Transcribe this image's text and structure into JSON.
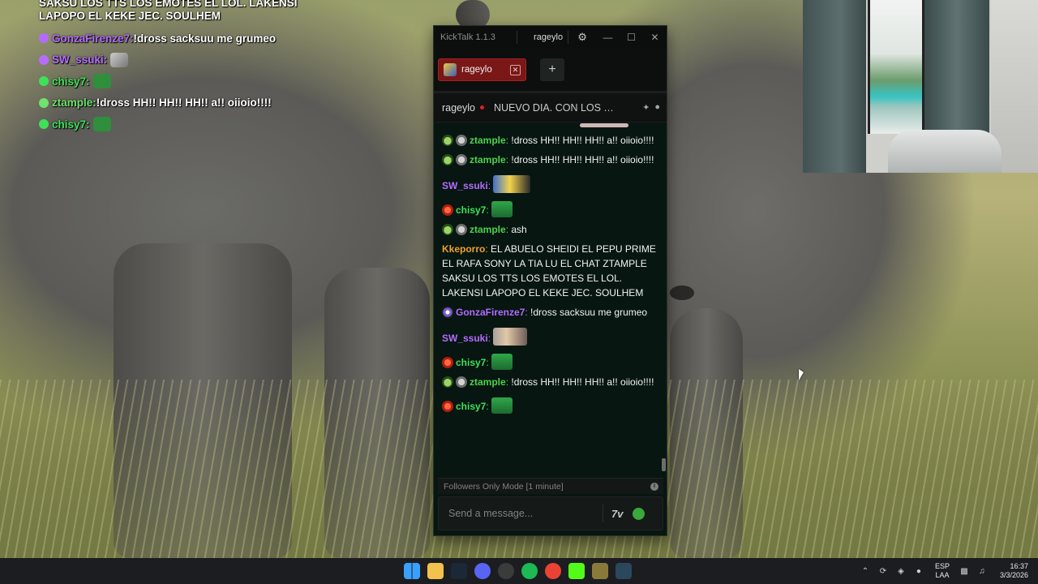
{
  "overlay_chat": {
    "lines": [
      {
        "text": "SAKSU LOS TTS LOS EMOTES EL LOL. LAKENSI LAPOPO EL KEKE JEC. SOULHEM",
        "color": "#ffffff"
      },
      {
        "user": "GonzaFirenze7",
        "sep": ":",
        "text": " !dross sacksuu me grumeo",
        "color": "#b36bff"
      },
      {
        "user": "SW_ssuki",
        "sep": ":",
        "text": "",
        "color": "#b56dff"
      },
      {
        "user": "chisy7",
        "sep": ":",
        "text": "",
        "color": "#3fe05a"
      },
      {
        "user": "ztample",
        "sep": ":",
        "text": " !dross HH!! HH!! HH!! a!! oiioio!!!!",
        "color": "#6ee36e"
      },
      {
        "user": "chisy7",
        "sep": ":",
        "text": "",
        "color": "#3fe05a"
      }
    ]
  },
  "window": {
    "app_title": "KickTalk 1.1.3",
    "user": "rageylo",
    "tab_label": "rageylo",
    "add_tab": "+",
    "channel_name": "rageylo",
    "stream_title": "NUEVO DIA. CON LOS TI...",
    "followers_notice": "Followers Only Mode [1 minute]",
    "input_placeholder": "Send a message...",
    "info": "i",
    "emote_btn": "7v"
  },
  "colors": {
    "green_user": "#3fe05a",
    "purple_user": "#b56dff",
    "orange_user": "#f0a12a",
    "tab_bg": "#7a1717"
  },
  "messages": [
    {
      "badges": [
        "bot",
        "gray"
      ],
      "user": "ztample",
      "user_color": "#4fd14f",
      "text": " !dross HH!! HH!! HH!! a!! oiioio!!!!",
      "emote": ""
    },
    {
      "badges": [
        "bot",
        "gray"
      ],
      "user": "ztample",
      "user_color": "#4fd14f",
      "text": " !dross HH!! HH!! HH!! a!! oiioio!!!!",
      "emote": ""
    },
    {
      "badges": [],
      "user": "SW_ssuki",
      "user_color": "#b56dff",
      "text": "",
      "emote": "pic"
    },
    {
      "badges": [
        "red"
      ],
      "user": "chisy7",
      "user_color": "#3fe05a",
      "text": "",
      "emote": "green"
    },
    {
      "badges": [
        "bot",
        "gray"
      ],
      "user": "ztample",
      "user_color": "#4fd14f",
      "text": " ash",
      "emote": ""
    },
    {
      "badges": [],
      "user": "Kkeporro",
      "user_color": "#f0a12a",
      "text": " EL ABUELO SHEIDI EL PEPU PRIME EL RAFA SONY LA TIA LU EL CHAT ZTAMPLE SAKSU LOS TTS LOS EMOTES EL LOL. LAKENSI LAPOPO EL KEKE JEC. SOULHEM",
      "emote": ""
    },
    {
      "badges": [
        "gonza"
      ],
      "user": "GonzaFirenze7",
      "user_color": "#b36bff",
      "text": " !dross sacksuu me grumeo",
      "emote": ""
    },
    {
      "badges": [],
      "user": "SW_ssuki",
      "user_color": "#b56dff",
      "text": "",
      "emote": "pic2"
    },
    {
      "badges": [
        "red"
      ],
      "user": "chisy7",
      "user_color": "#3fe05a",
      "text": "",
      "emote": "green"
    },
    {
      "badges": [
        "bot",
        "gray"
      ],
      "user": "ztample",
      "user_color": "#4fd14f",
      "text": " !dross HH!! HH!! HH!! a!! oiioio!!!!",
      "emote": ""
    },
    {
      "badges": [
        "red"
      ],
      "user": "chisy7",
      "user_color": "#3fe05a",
      "text": "",
      "emote": "green"
    }
  ],
  "taskbar": {
    "apps": [
      {
        "name": "windows-start-icon",
        "color": "#3aa0ff"
      },
      {
        "name": "file-explorer-icon",
        "color": "#f2c14e"
      },
      {
        "name": "steam-icon",
        "color": "#1b2838"
      },
      {
        "name": "discord-icon",
        "color": "#5865f2"
      },
      {
        "name": "obs-icon",
        "color": "#3b3b3b"
      },
      {
        "name": "spotify-icon",
        "color": "#1db954"
      },
      {
        "name": "chrome-icon",
        "color": "#ea4335"
      },
      {
        "name": "kick-icon",
        "color": "#53fc18"
      },
      {
        "name": "game-icon",
        "color": "#8a7a3a"
      },
      {
        "name": "steam-icon-2",
        "color": "#2a475e"
      }
    ],
    "lang_top": "ESP",
    "lang_bottom": "LAA",
    "time": "16:37",
    "date": "3/3/2026"
  }
}
